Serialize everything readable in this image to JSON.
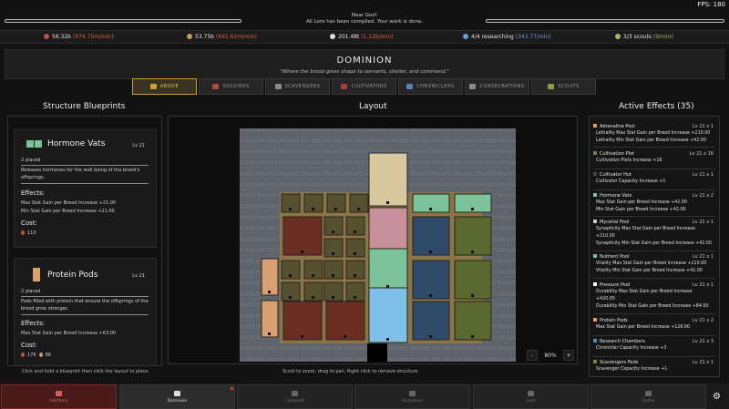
{
  "fps": "FPS: 180",
  "notice": [
    "Near God!",
    "All Lore has been compiled. Your work is done."
  ],
  "resources": [
    {
      "value": "56.32b",
      "rate": "(974.75m/min)",
      "color": "#c0504a"
    },
    {
      "value": "53.75b",
      "rate": "(691.62m/min)",
      "color": "#c0a060"
    },
    {
      "value": "201.48t",
      "rate": "(1.12b/min)",
      "color": "#dddddd"
    },
    {
      "value": "4/4 researching",
      "rate": "(343.77/min)",
      "color": "#6a9bd8"
    },
    {
      "value": "3/3 scouts",
      "rate": "(9/min)",
      "color": "#b0b060"
    }
  ],
  "title": "DOMINION",
  "subtitle": "\"Where the brood gives shape to servants, shelter, and command.\"",
  "tabs": [
    {
      "label": "ABODE",
      "color": "#c9a030"
    },
    {
      "label": "SOLDIERS",
      "color": "#b04a3a"
    },
    {
      "label": "SCAVENGERS",
      "color": "#8a8a8a"
    },
    {
      "label": "CULTIVATORS",
      "color": "#a04040"
    },
    {
      "label": "CHRONICLERS",
      "color": "#5a7fb0"
    },
    {
      "label": "CONSECRATIONS",
      "color": "#8a8a8a"
    },
    {
      "label": "SCOUTS",
      "color": "#8aa040"
    }
  ],
  "left_header": "Structure Blueprints",
  "center_header": "Layout",
  "right_header": "Active Effects (35)",
  "blueprints": [
    {
      "name": "Hormone Vats",
      "level": "Lv 21",
      "placed": "2 placed",
      "desc": "Releases hormones for the well being of the brood's offsprings.",
      "effects_label": "Effects:",
      "effects": [
        "Max Stat Gain per Breed Increase +21.00",
        "Min Stat Gain per Breed Increase +21.00"
      ],
      "cost_label": "Cost:",
      "cost": [
        "110"
      ],
      "color": "#7cc29a"
    },
    {
      "name": "Protein Pods",
      "level": "Lv 21",
      "placed": "2 placed",
      "desc": "Pods filled with protein that ensure the offsprings of the brood grow stronger.",
      "effects_label": "Effects:",
      "effects": [
        "Max Stat Gain per Breed Increase +63.00"
      ],
      "cost_label": "Cost:",
      "cost": [
        "176",
        "86"
      ],
      "color": "#d9a070"
    }
  ],
  "left_hint": "Click and hold a blueprint then click the layout to place.",
  "center_hint": "Scroll to zoom, drag to pan. Right click to remove structure.",
  "zoom": {
    "minus": "-",
    "level": "80%",
    "plus": "+"
  },
  "effects": [
    {
      "name": "Adrenaline Pool",
      "level": "Lv 21 x 1",
      "color": "#d9a070",
      "lines": [
        "Lethality Max Stat Gain per Breed Increase +210.00",
        "Lethality Min Stat Gain per Breed Increase +42.00"
      ]
    },
    {
      "name": "Cultivation Plot",
      "level": "Lv 21 x 16",
      "color": "#8a7a40",
      "lines": [
        "Cultivation Plots Increase +16"
      ]
    },
    {
      "name": "Cultivator Hut",
      "level": "Lv 21 x 1",
      "color": "#444444",
      "lines": [
        "Cultivator Capacity Increase +1"
      ]
    },
    {
      "name": "Hormone Vats",
      "level": "Lv 21 x 2",
      "color": "#7cc29a",
      "lines": [
        "Max Stat Gain per Breed Increase +42.00",
        "Min Stat Gain per Breed Increase +42.00"
      ]
    },
    {
      "name": "Mycelial Pool",
      "level": "Lv 21 x 1",
      "color": "#c0d0e0",
      "lines": [
        "Synapticity Max Stat Gain per Breed Increase",
        "+210.00",
        "Synapticity Min Stat Gain per Breed Increase +42.00"
      ]
    },
    {
      "name": "Nutrient Pool",
      "level": "Lv 21 x 1",
      "color": "#7cc29a",
      "lines": [
        "Vitality Max Stat Gain per Breed Increase +210.00",
        "Vitality Min Stat Gain per Breed Increase +42.00"
      ]
    },
    {
      "name": "Pressure Pool",
      "level": "Lv 21 x 1",
      "color": "#ffffff",
      "lines": [
        "Durability Max Stat Gain per Breed Increase",
        "+420.00",
        "Durability Min Stat Gain per Breed Increase +84.00"
      ]
    },
    {
      "name": "Protein Pods",
      "level": "Lv 21 x 2",
      "color": "#d9a070",
      "lines": [
        "Max Stat Gain per Breed Increase +126.00"
      ]
    },
    {
      "name": "Research Chambers",
      "level": "Lv 21 x 3",
      "color": "#4a8ac0",
      "lines": [
        "Chronicler Capacity Increase +3"
      ]
    },
    {
      "name": "Scavengers Pods",
      "level": "Lv 21 x 1",
      "color": "#6a8a50",
      "lines": [
        "Scavenger Capacity Increase +1"
      ]
    }
  ],
  "nav": [
    {
      "label": "Hatchery"
    },
    {
      "label": "Dominion"
    },
    {
      "label": "Conquest"
    },
    {
      "label": "Ascension"
    },
    {
      "label": "Lore"
    },
    {
      "label": "Codex"
    }
  ],
  "settings_icon": "gear-icon"
}
